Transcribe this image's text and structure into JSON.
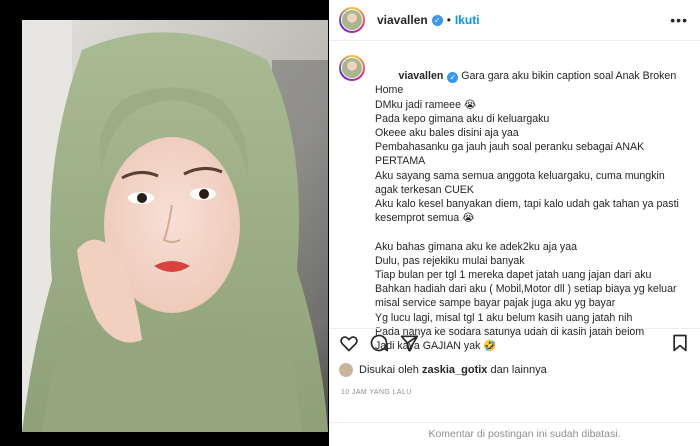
{
  "post": {
    "username": "viavallen",
    "verified_icon": "verified-check-icon",
    "separator": "•",
    "follow_label": "Ikuti",
    "more_icon": "more-options-icon",
    "caption_lines": [
      "Gara gara aku bikin caption soal Anak Broken Home",
      "DMku jadi rameee 😭",
      "Pada kepo gimana aku di keluargaku",
      "Okeee aku bales disini aja yaa",
      "Pembahasanku ga jauh jauh soal peranku sebagai ANAK",
      "PERTAMA",
      "Aku sayang sama semua anggota keluargaku, cuma mungkin",
      "agak terkesan CUEK",
      "Aku kalo kesel banyakan diem, tapi kalo udah gak tahan ya pasti",
      "kesemprot semua 😭",
      "",
      "Aku bahas gimana aku ke adek2ku aja yaa",
      "Dulu, pas rejekiku mulai banyak",
      "Tiap bulan per tgl 1 mereka dapet jatah uang jajan dari aku",
      "Bahkan hadiah dari aku ( Mobil,Motor dll ) setiap biaya yg keluar",
      "misal service sampe bayar pajak juga aku yg bayar",
      "Yg lucu lagi, misal tgl 1 aku belum kasih uang jatah nih",
      "Pada nanya ke sodara satunya udah di kasih jatah belom",
      "Jadi kaya GAJIAN yak 🤣"
    ],
    "liked_by_prefix": "Disukai oleh",
    "liked_by_user": "zaskia_gotix",
    "liked_by_suffix": "dan lainnya",
    "timestamp": "10 JAM YANG LALU",
    "comments_disabled": "Komentar di postingan ini sudah dibatasi.",
    "action_icons": [
      "heart-icon",
      "comment-icon",
      "share-icon",
      "bookmark-icon"
    ]
  },
  "colors": {
    "link_blue": "#0095f6",
    "verified_blue": "#3897f0",
    "muted_gray": "#8e8e8e",
    "text": "#262626",
    "hijab_green": "#9fb38a"
  }
}
